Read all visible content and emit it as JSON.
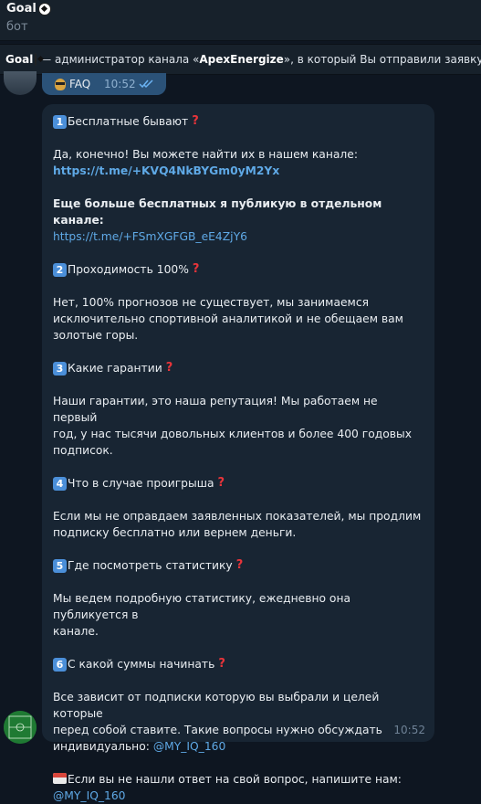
{
  "header": {
    "title": "Goal",
    "subtitle": "бот"
  },
  "notice": {
    "bot_name": "Goal",
    "text_before": " — администратор канала «",
    "channel": "ApexEnergize",
    "text_after": "», в который Вы отправили заявку."
  },
  "faq_reply": {
    "label": "FAQ",
    "time": "10:52"
  },
  "message": {
    "time": "10:52",
    "free_q_num": "1",
    "free_q": "Бесплатные бывают",
    "free_a": "Да, конечно! Вы можете найти их в нашем канале:",
    "free_link": "https://t.me/+KVQ4NkBYGm0yM2Yx",
    "more_free": "Еще больше бесплатных я публикую в отдельном канале:",
    "more_free_link": "https://t.me/+FSmXGFGB_eE4ZjY6",
    "q2_num": "2",
    "q2": "Проходимость 100%",
    "a2": [
      "Нет, 100% прогнозов не существует, мы занимаемся",
      "исключительно спортивной аналитикой и не обещаем вам",
      "золотые горы."
    ],
    "q3_num": "3",
    "q3": "Какие гарантии",
    "a3": [
      "Наши гарантии, это наша репутация! Мы работаем не первый",
      "год, у нас тысячи довольных клиентов и более 400 годовых",
      "подписок."
    ],
    "q4_num": "4",
    "q4": "Что в случае проигрыша",
    "a4": [
      "Если мы не оправдаем заявленных показателей, мы продлим",
      "подписку бесплатно или вернем деньги."
    ],
    "q5_num": "5",
    "q5": "Где посмотреть статистику",
    "a5": [
      "Мы ведем подробную статистику, ежедневно она публикуется в",
      "канале."
    ],
    "q6_num": "6",
    "q6": "С какой суммы начинать",
    "a6": [
      "Все зависит от подписки которую вы выбрали и целей которые",
      "перед собой ставите. Такие вопросы нужно обсуждать",
      "индивидуально: "
    ],
    "a6_contact": "@MY_IQ_160",
    "footer": "Если вы не нашли ответ на свой вопрос, напишите нам:",
    "footer_contact": "@MY_IQ_160"
  }
}
